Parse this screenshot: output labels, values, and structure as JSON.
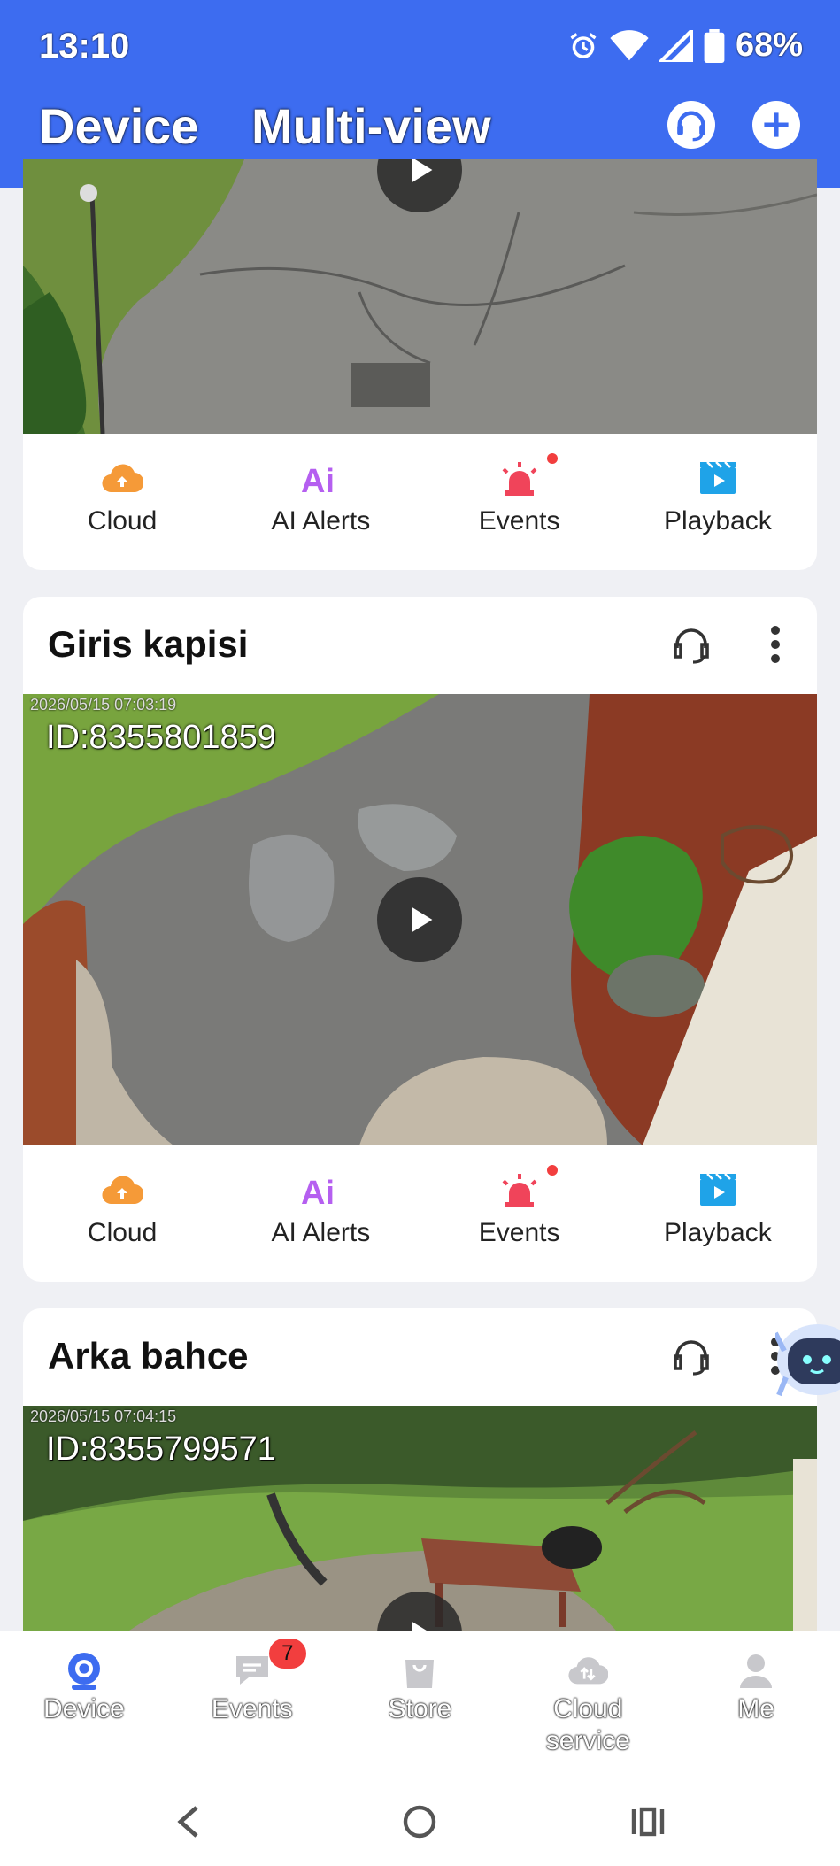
{
  "status": {
    "time": "13:10",
    "battery": "68%"
  },
  "header": {
    "tabs": [
      "Device",
      "Multi-view"
    ]
  },
  "cards": [
    {
      "actions": [
        "Cloud",
        "AI Alerts",
        "Events",
        "Playback"
      ],
      "icons": [
        "cloud-icon",
        "ai-icon",
        "alarm-icon",
        "playback-icon"
      ]
    },
    {
      "title": "Giris kapisi",
      "camera_id": "ID:8355801859",
      "timestamp": "2026/05/15 07:03:19",
      "actions": [
        "Cloud",
        "AI Alerts",
        "Events",
        "Playback"
      ]
    },
    {
      "title": "Arka bahce",
      "camera_id": "ID:8355799571",
      "timestamp": "2026/05/15 07:04:15"
    }
  ],
  "bottom_nav": {
    "items": [
      "Device",
      "Events",
      "Store",
      "Cloud service",
      "Me"
    ],
    "events_badge": "7",
    "active": "Device"
  },
  "colors": {
    "brand": "#3d6cf0",
    "cloud": "#f59a38",
    "ai": "#b55ff0",
    "events": "#f0445a",
    "playback": "#1fa3e8"
  }
}
